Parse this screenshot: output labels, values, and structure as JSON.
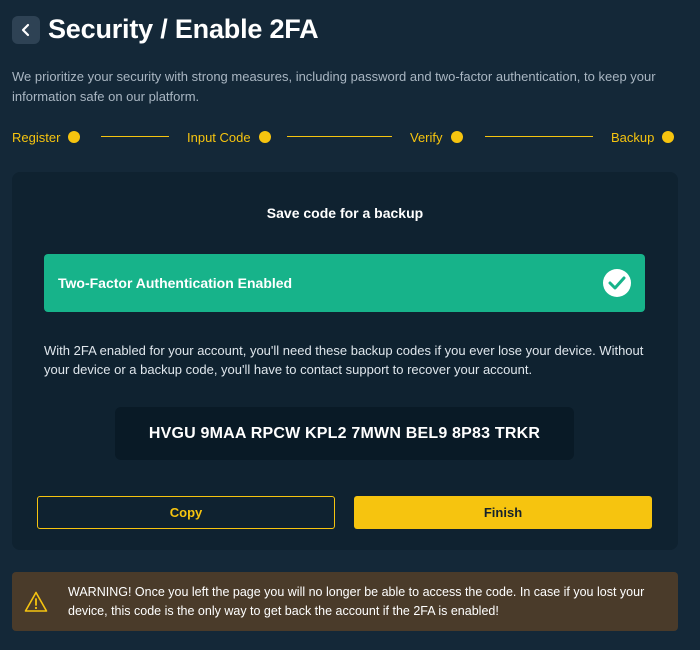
{
  "header": {
    "title": "Security / Enable 2FA"
  },
  "intro": {
    "text": "We prioritize your security with strong measures, including password and two-factor authentication, to keep your information safe on our platform."
  },
  "stepper": {
    "steps": [
      {
        "label": "Register"
      },
      {
        "label": "Input Code"
      },
      {
        "label": "Verify"
      },
      {
        "label": "Backup"
      }
    ]
  },
  "card": {
    "title": "Save code for a backup",
    "banner_text": "Two-Factor Authentication Enabled",
    "description": "With 2FA enabled for your account, you'll need these backup codes if you ever lose your device. Without your device or a backup code, you'll have to contact support to recover your account.",
    "backup_code": "HVGU 9MAA RPCW KPL2 7MWN BEL9 8P83 TRKR",
    "copy_label": "Copy",
    "finish_label": "Finish"
  },
  "warning": {
    "text": "WARNING! Once you left the page you will no longer be able to access the code. In case if you lost your device, this code is the only way to get back the account if the 2FA is enabled!"
  },
  "colors": {
    "background": "#142838",
    "card": "#0f2230",
    "accent": "#f6c40f",
    "success": "#17b38a",
    "warning_bg": "#4a3b2a"
  },
  "icons": {
    "back": "chevron-left-icon",
    "success": "check-circle-icon",
    "warning": "warning-triangle-icon"
  }
}
